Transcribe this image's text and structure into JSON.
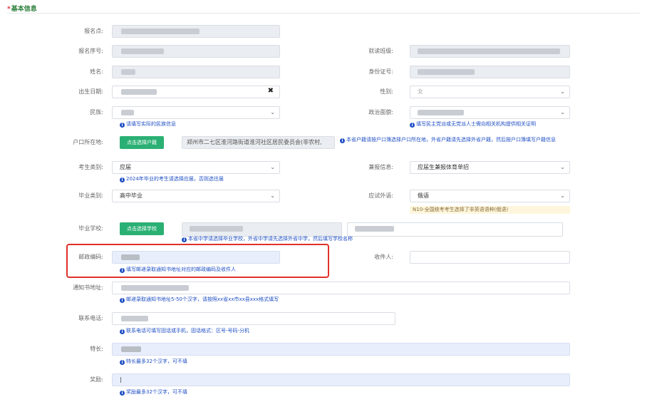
{
  "section": {
    "star": "*",
    "title": "基本信息"
  },
  "labels": {
    "baomingdian": "报名点:",
    "baomingxuhao": "报名序号:",
    "jiudubanji": "就读班级:",
    "xingming": "姓名:",
    "shenfenzheng": "身份证号:",
    "chusheng": "出生日期:",
    "xingbie": "性别:",
    "minzu": "民族:",
    "zhengzhi": "政治面貌:",
    "hukou": "户口所在地:",
    "kaoshengleibie": "考生类别:",
    "jianbao": "兼报信息:",
    "biyeleibie": "毕业类别:",
    "yingshiwaiyu": "应试外语:",
    "biyexuexiao": "毕业学校:",
    "youzheng": "邮政编码:",
    "shoujianren": "收件人:",
    "tongzhishu": "通知书地址:",
    "lianxidianhua": "联系电话:",
    "techang": "特长:",
    "jiangli": "奖励:"
  },
  "values": {
    "xingbie": "女",
    "hukou_text": "郑州市二七区淮河路街道淮河社区居民委员会(非农村,",
    "kaoshengleibie": "应届",
    "jianbao": "应届生兼报体育单招",
    "biyeleibie": "高中毕业",
    "yingshiwaiyu": "俄语",
    "jiangli_cursor": "|"
  },
  "buttons": {
    "select_hukou": "点击选择户籍",
    "select_school": "点击选择学校"
  },
  "hints": {
    "minzu": "请填写实际的民族信息",
    "zhengzhi": "填写民主党派或无党派人士需向相关机构提供相关证明",
    "hukou": "本省户籍请按户口簿选择户口所在地，外省户籍请先选择外省户籍，然后按户口簿填写户籍信息",
    "kaoshengleibie": "2024年毕业的考生请选择应届，否则选往届",
    "waiyu_note": "N10-全国统考考生选择了非英语语种(俄语)",
    "biyexuexiao": "本省中学请选择毕业学校，外省中学请先选择外省中学，然后填写学校名称",
    "youzheng": "填写邮递录取通知书地址对应的邮政编码及收件人",
    "tongzhishu": "邮递录取通知书地址5-50个汉字，请按照xx省xx市xx县xxx格式填写",
    "lianxidianhua": "联系电话可填写固话或手机，固话格式：区号-号码-分机",
    "techang": "特长最多32个汉字，可不填",
    "jiangli": "奖励最多32个汉字，可不填"
  },
  "icons": {
    "info": "i",
    "chevron": "⌄",
    "clear": "✖"
  },
  "colors": {
    "accent_green": "#2bb074",
    "hint_blue": "#1f4fc4",
    "highlight_red": "#e0302a"
  }
}
